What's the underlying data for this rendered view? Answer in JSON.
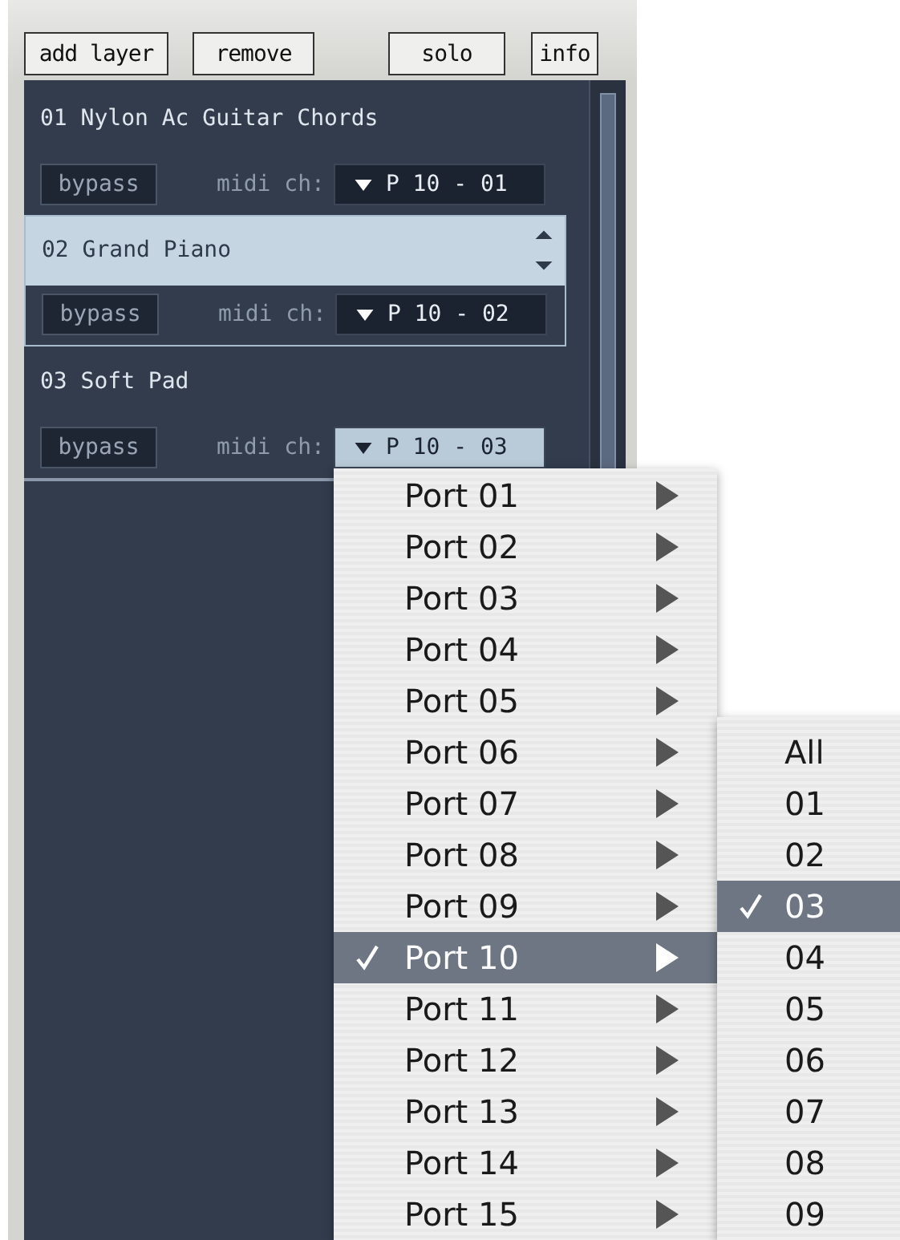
{
  "toolbar": [
    {
      "label": "add layer"
    },
    {
      "label": "remove"
    },
    {
      "label": "solo"
    },
    {
      "label": "info"
    }
  ],
  "layers": [
    {
      "number": "01",
      "name": "Nylon Ac Guitar Chords",
      "selected": false,
      "bypass": "bypass",
      "midi_label": "midi ch:",
      "midi_value": "P 10 - 01",
      "open": false
    },
    {
      "number": "02",
      "name": "Grand Piano",
      "selected": true,
      "bypass": "bypass",
      "midi_label": "midi ch:",
      "midi_value": "P 10 - 02",
      "open": false
    },
    {
      "number": "03",
      "name": "Soft Pad",
      "selected": false,
      "bypass": "bypass",
      "midi_label": "midi ch:",
      "midi_value": "P 10 - 03",
      "open": true
    }
  ],
  "port_menu": [
    {
      "label": "Port 01",
      "selected": false
    },
    {
      "label": "Port 02",
      "selected": false
    },
    {
      "label": "Port 03",
      "selected": false
    },
    {
      "label": "Port 04",
      "selected": false
    },
    {
      "label": "Port 05",
      "selected": false
    },
    {
      "label": "Port 06",
      "selected": false
    },
    {
      "label": "Port 07",
      "selected": false
    },
    {
      "label": "Port 08",
      "selected": false
    },
    {
      "label": "Port 09",
      "selected": false
    },
    {
      "label": "Port 10",
      "selected": true
    },
    {
      "label": "Port 11",
      "selected": false
    },
    {
      "label": "Port 12",
      "selected": false
    },
    {
      "label": "Port 13",
      "selected": false
    },
    {
      "label": "Port 14",
      "selected": false
    },
    {
      "label": "Port 15",
      "selected": false
    }
  ],
  "channel_menu": [
    {
      "label": "All",
      "selected": false
    },
    {
      "label": "01",
      "selected": false
    },
    {
      "label": "02",
      "selected": false
    },
    {
      "label": "03",
      "selected": true
    },
    {
      "label": "04",
      "selected": false
    },
    {
      "label": "05",
      "selected": false
    },
    {
      "label": "06",
      "selected": false
    },
    {
      "label": "07",
      "selected": false
    },
    {
      "label": "08",
      "selected": false
    },
    {
      "label": "09",
      "selected": false
    }
  ]
}
